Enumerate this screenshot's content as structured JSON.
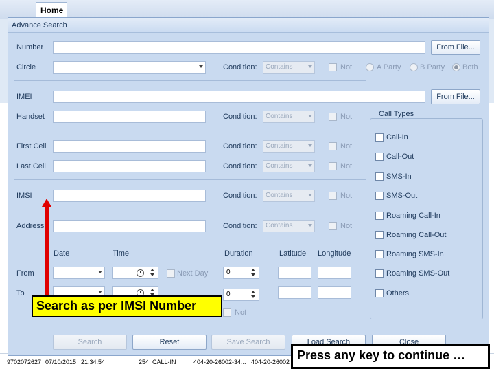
{
  "ribbon": {
    "home_tab": "Home"
  },
  "dialog": {
    "title": "Advance Search",
    "from_file_label": "From File...",
    "condition_label": "Condition:",
    "condition_value": "Contains",
    "not_label": "Not",
    "fields": {
      "number": "Number",
      "circle": "Circle",
      "imei": "IMEI",
      "handset": "Handset",
      "first_cell": "First Cell",
      "last_cell": "Last Cell",
      "imsi": "IMSI",
      "address": "Address"
    },
    "party_options": [
      "A Party",
      "B Party",
      "Both"
    ],
    "party_selected": "Both",
    "call_types": {
      "title": "Call Types",
      "items": [
        "Call-In",
        "Call-Out",
        "SMS-In",
        "SMS-Out",
        "Roaming Call-In",
        "Roaming Call-Out",
        "Roaming SMS-In",
        "Roaming SMS-Out",
        "Others"
      ]
    },
    "headers": {
      "date": "Date",
      "time": "Time",
      "duration": "Duration",
      "latitude": "Latitude",
      "longitude": "Longitude"
    },
    "from_label": "From",
    "to_label": "To",
    "next_day_label": "Next Day",
    "duration_from": "0",
    "duration_to": "0",
    "buttons": {
      "search": "Search",
      "reset": "Reset",
      "save_search": "Save Search",
      "load_search": "Load Search",
      "close": "Close"
    }
  },
  "background_row": {
    "number": "9702072627",
    "date": "07/10/2015",
    "time": "21:34:54",
    "duration": "254",
    "type": "CALL-IN",
    "cell_a": "404-20-26002-34...",
    "cell_b": "404-20-26002"
  },
  "annotations": {
    "callout": "Search as per IMSI Number",
    "continue": "Press any key to continue …"
  },
  "colors": {
    "dialog_bg": "#c9daf0",
    "callout_bg": "#ffff00",
    "arrow": "#e00000"
  }
}
